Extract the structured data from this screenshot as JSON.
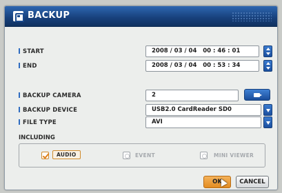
{
  "dialog": {
    "title": "BACKUP"
  },
  "fields": {
    "start_label": "START",
    "start_value": "2008 / 03 / 04   00 : 46 : 01",
    "end_label": "END",
    "end_value": "2008 / 03 / 04   00 : 53 : 34",
    "camera_label": "BACKUP CAMERA",
    "camera_value": "2",
    "device_label": "BACKUP DEVICE",
    "device_value": "USB2.0 CardReader SD0",
    "filetype_label": "FILE TYPE",
    "filetype_value": "AVI"
  },
  "including": {
    "label": "INCLUDING",
    "options": [
      {
        "label": "AUDIO",
        "checked": true
      },
      {
        "label": "EVENT",
        "checked": false
      },
      {
        "label": "MINI VIEWER",
        "checked": false
      }
    ]
  },
  "buttons": {
    "ok": "OK",
    "cancel": "CANCEL"
  },
  "colors": {
    "titlebar": "#1b4a8d",
    "accent_blue": "#2e6bc0",
    "ok_orange": "#e38c21",
    "check_orange": "#e07f18"
  },
  "icons": [
    "backup-title-icon",
    "spin-up-down-icon",
    "dropdown-arrow-icon",
    "camera-icon",
    "checkmark-icon",
    "mouse-cursor-icon"
  ]
}
